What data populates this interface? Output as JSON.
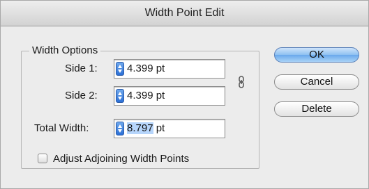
{
  "dialog": {
    "title": "Width Point Edit"
  },
  "width_options": {
    "legend": "Width Options",
    "side1": {
      "label": "Side 1:",
      "value": "4.399 pt"
    },
    "side2": {
      "label": "Side 2:",
      "value": "4.399 pt"
    },
    "total": {
      "label": "Total Width:",
      "num": "8.797",
      "unit": " pt"
    },
    "link_icon": "chain-link-icon"
  },
  "adjust": {
    "label": "Adjust Adjoining Width Points",
    "checked": false
  },
  "buttons": {
    "ok": "OK",
    "cancel": "Cancel",
    "delete": "Delete"
  },
  "colors": {
    "accent": "#6aa9ec",
    "selection": "#b6d5fb"
  }
}
